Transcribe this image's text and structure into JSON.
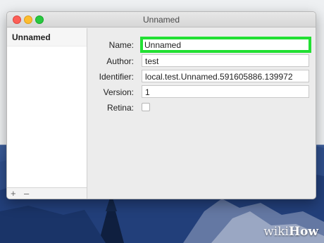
{
  "window": {
    "title": "Unnamed"
  },
  "sidebar": {
    "items": [
      {
        "label": "Unnamed"
      }
    ],
    "add_label": "+",
    "remove_label": "–"
  },
  "form": {
    "name": {
      "label": "Name:",
      "value": "Unnamed"
    },
    "author": {
      "label": "Author:",
      "value": "test"
    },
    "identifier": {
      "label": "Identifier:",
      "value": "local.test.Unnamed.591605886.139972"
    },
    "version": {
      "label": "Version:",
      "value": "1"
    },
    "retina": {
      "label": "Retina:",
      "checked": false
    }
  },
  "watermark": {
    "wiki": "wiki",
    "how": "How"
  },
  "colors": {
    "highlight": "#22e033",
    "desktop": "#2a4a88"
  }
}
